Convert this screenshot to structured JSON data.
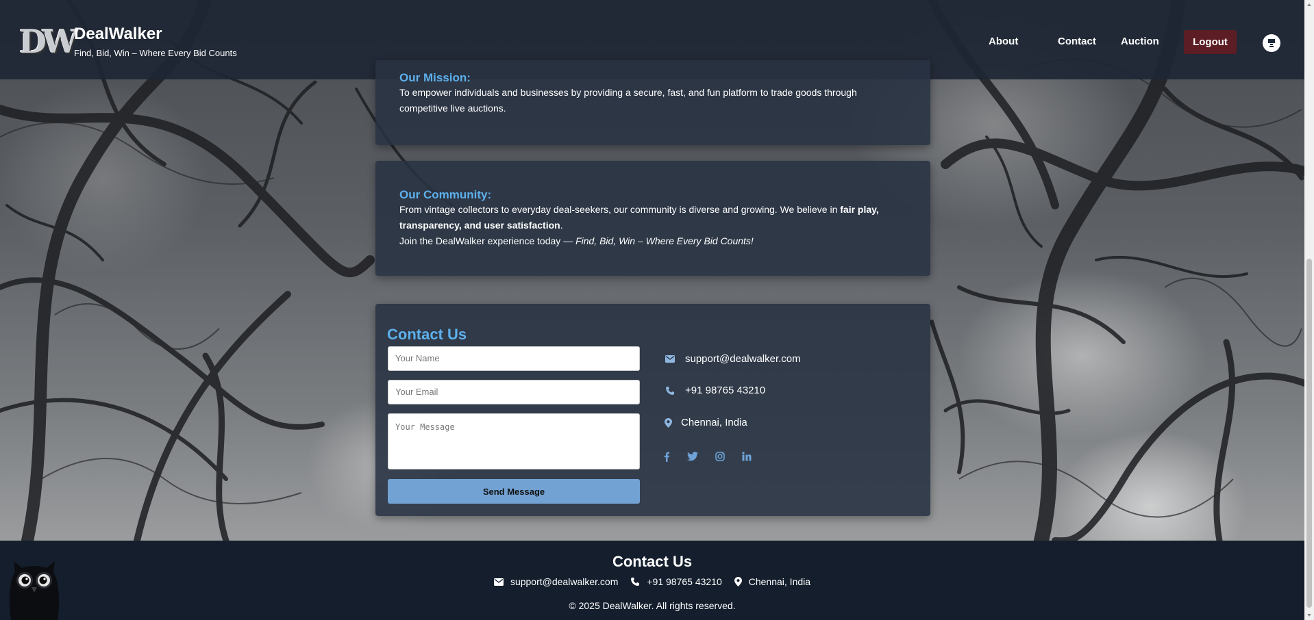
{
  "header": {
    "logo_text": "DW",
    "brand_name": "DealWalker",
    "tagline": "Find, Bid, Win – Where Every Bid Counts",
    "nav": [
      "About",
      "Contact",
      "Auction"
    ],
    "logout_label": "Logout",
    "user_icon": "user-icon"
  },
  "mission": {
    "title": "Our Mission:",
    "text": "To empower individuals and businesses by providing a secure, fast, and fun platform to trade goods through competitive live auctions."
  },
  "community": {
    "title": "Our Community:",
    "text_1": "From vintage collectors to everyday deal-seekers, our community is diverse and growing. We believe in ",
    "text_bold": "fair play, transparency, and user satisfaction",
    "text_2": ".",
    "join_text": "Join the DealWalker experience today — ",
    "join_italic": "Find, Bid, Win – Where Every Bid Counts!"
  },
  "contact": {
    "title": "Contact Us",
    "name_placeholder": "Your Name",
    "email_placeholder": "Your Email",
    "message_placeholder": "Your Message",
    "send_label": "Send Message",
    "email": "support@dealwalker.com",
    "phone": "+91 98765 43210",
    "location": "Chennai, India",
    "socials": [
      "facebook-icon",
      "twitter-icon",
      "instagram-icon",
      "linkedin-icon"
    ]
  },
  "footer": {
    "title": "Contact Us",
    "email": "support@dealwalker.com",
    "phone": "+91 98765 43210",
    "location": "Chennai, India",
    "copyright": "© 2025 DealWalker. All rights reserved."
  },
  "colors": {
    "accent": "#5db0ec",
    "logout_bg": "#5c1d24",
    "send_button": "#72a2d4",
    "footer_bg": "#141e2d"
  }
}
